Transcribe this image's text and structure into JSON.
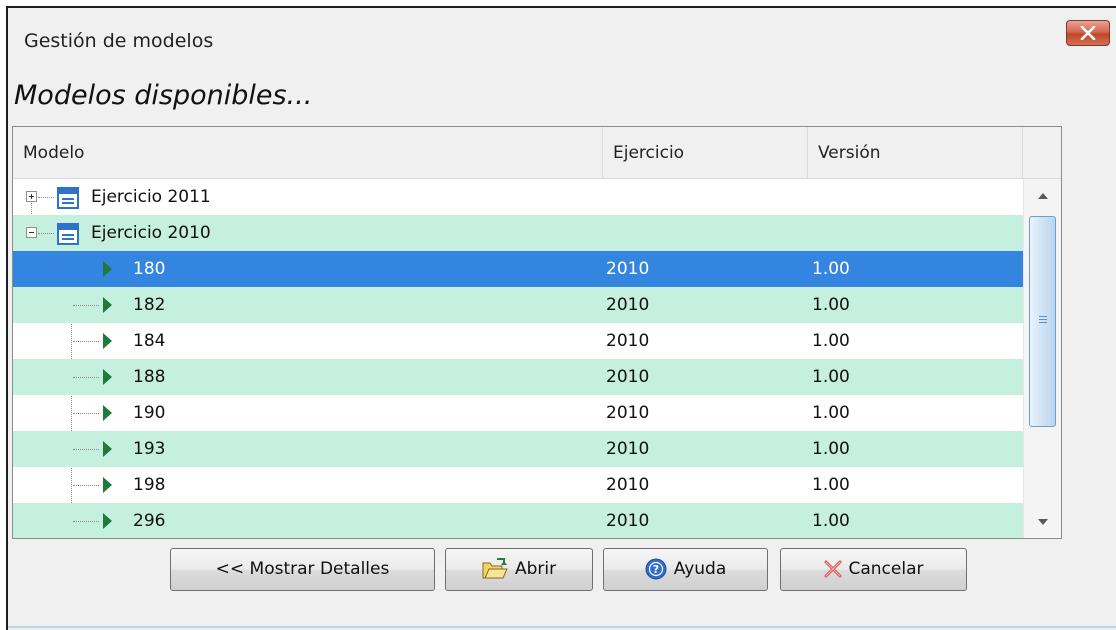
{
  "window": {
    "title": "Gestión de modelos",
    "close_icon": "close-icon",
    "accent_close": "#c94a2e"
  },
  "heading": "Modelos disponibles...",
  "table": {
    "columns": [
      "Modelo",
      "Ejercicio",
      "Versión"
    ],
    "groups": [
      {
        "label": "Ejercicio 2011",
        "expanded": false
      },
      {
        "label": "Ejercicio 2010",
        "expanded": true
      }
    ],
    "rows": [
      {
        "modelo": "180",
        "ejercicio": "2010",
        "version": "1.00",
        "selected": true
      },
      {
        "modelo": "182",
        "ejercicio": "2010",
        "version": "1.00"
      },
      {
        "modelo": "184",
        "ejercicio": "2010",
        "version": "1.00"
      },
      {
        "modelo": "188",
        "ejercicio": "2010",
        "version": "1.00"
      },
      {
        "modelo": "190",
        "ejercicio": "2010",
        "version": "1.00"
      },
      {
        "modelo": "193",
        "ejercicio": "2010",
        "version": "1.00"
      },
      {
        "modelo": "198",
        "ejercicio": "2010",
        "version": "1.00"
      },
      {
        "modelo": "296",
        "ejercicio": "2010",
        "version": "1.00"
      }
    ],
    "colors": {
      "alt_row": "#c5efde",
      "selected_row": "#3385e0",
      "row_arrow": "#1e7a3a"
    }
  },
  "buttons": {
    "details": "<< Mostrar Detalles",
    "open": "Abrir",
    "help": "Ayuda",
    "cancel": "Cancelar"
  }
}
